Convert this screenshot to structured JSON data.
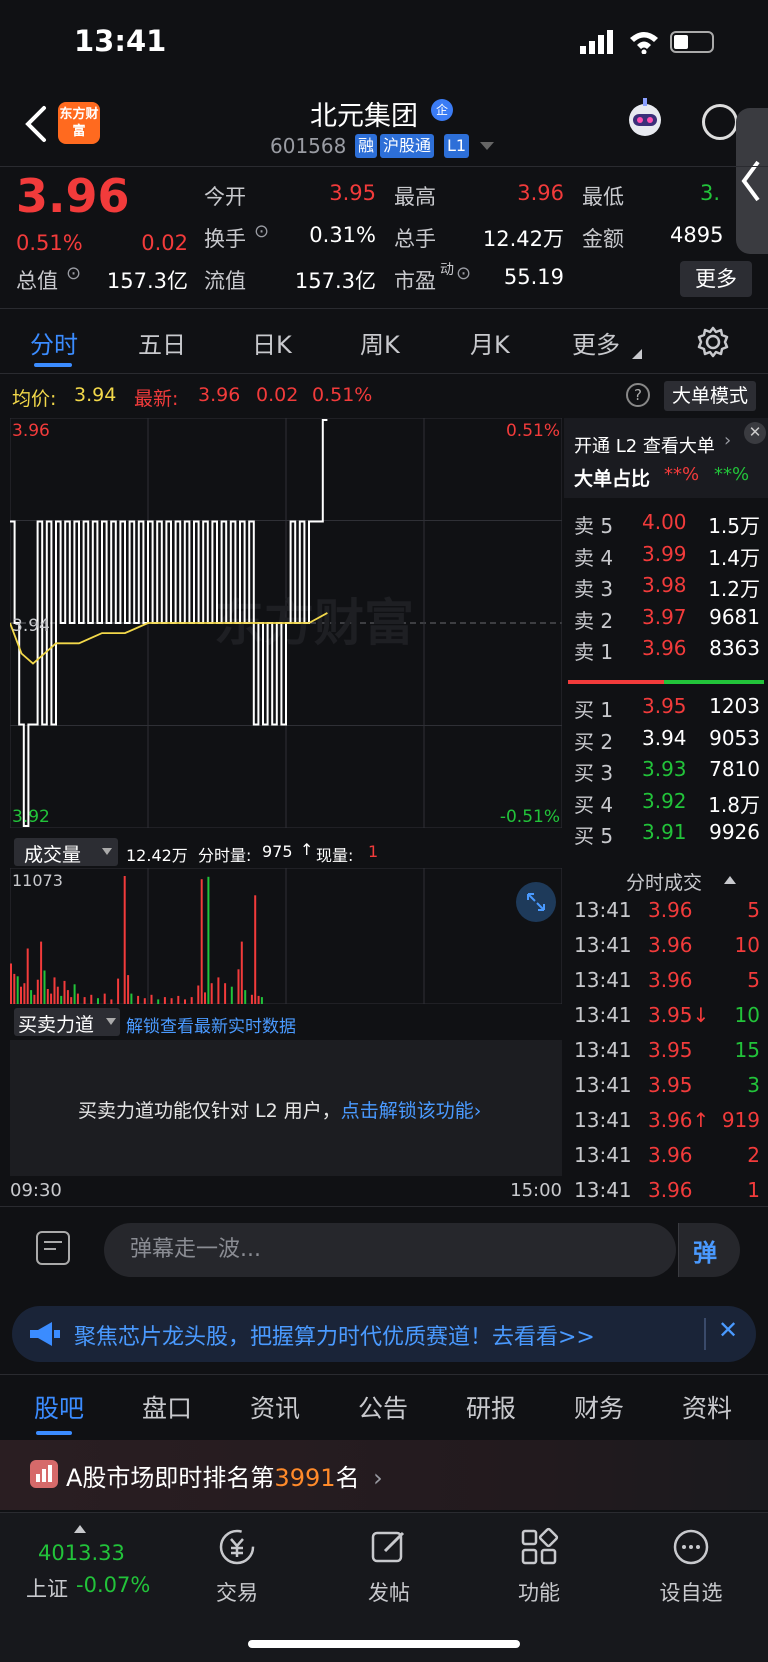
{
  "status": {
    "time": "13:41"
  },
  "header": {
    "brand": "东方财富",
    "stock_name": "北元集团",
    "badge": "企",
    "stock_code": "601568",
    "tags": [
      "融",
      "沪股通",
      "L1"
    ]
  },
  "quote": {
    "price": "3.96",
    "change_pct": "0.51%",
    "change": "0.02",
    "fields": {
      "open_label": "今开",
      "open": "3.95",
      "high_label": "最高",
      "high": "3.96",
      "low_label": "最低",
      "low": "3.",
      "turnover_label": "换手",
      "turnover": "0.31%",
      "volume_label": "总手",
      "volume": "12.42万",
      "amount_label": "金额",
      "amount": "4895",
      "mktcap_label": "总值",
      "mktcap": "157.3亿",
      "float_label": "流值",
      "float": "157.3亿",
      "pe_label": "市盈",
      "pe_sup": "动",
      "pe": "55.19"
    },
    "more": "更多"
  },
  "period_tabs": [
    "分时",
    "五日",
    "日K",
    "周K",
    "月K",
    "更多"
  ],
  "avg_row": {
    "avg_label": "均价:",
    "avg": "3.94",
    "latest_label": "最新:",
    "latest": "3.96",
    "latest_change": "0.02",
    "latest_pct": "0.51%",
    "big_order_mode": "大单模式"
  },
  "chart_labels": {
    "top_price": "3.96",
    "mid_price": "3.94",
    "bottom_price": "3.92",
    "top_pct": "0.51%",
    "bottom_pct": "-0.51%",
    "watermark": "东方财富"
  },
  "volume": {
    "selector": "成交量",
    "summary_total": "12.42万",
    "summary_min_label": "分时量:",
    "summary_min": "975",
    "summary_now_label": "现量:",
    "summary_now": "1",
    "max": "11073"
  },
  "force": {
    "selector": "买卖力道",
    "unlock_link": "解锁查看最新实时数据",
    "message": "买卖力道功能仅针对 L2 用户，",
    "message_link": "点击解锁该功能"
  },
  "time_axis": {
    "start": "09:30",
    "end": "15:00"
  },
  "right_panel": {
    "l2_link": "开通 L2 查看大单",
    "big_ratio_label": "大单占比",
    "big_ratio_red": "**%",
    "big_ratio_green": "**%",
    "asks": [
      {
        "label": "卖 5",
        "price": "4.00",
        "vol": "1.5万",
        "color": "red"
      },
      {
        "label": "卖 4",
        "price": "3.99",
        "vol": "1.4万",
        "color": "red"
      },
      {
        "label": "卖 3",
        "price": "3.98",
        "vol": "1.2万",
        "color": "red"
      },
      {
        "label": "卖 2",
        "price": "3.97",
        "vol": "9681",
        "color": "red"
      },
      {
        "label": "卖 1",
        "price": "3.96",
        "vol": "8363",
        "color": "red"
      }
    ],
    "bids": [
      {
        "label": "买 1",
        "price": "3.95",
        "vol": "1203",
        "color": "red"
      },
      {
        "label": "买 2",
        "price": "3.94",
        "vol": "9053",
        "color": "white"
      },
      {
        "label": "买 3",
        "price": "3.93",
        "vol": "7810",
        "color": "green"
      },
      {
        "label": "买 4",
        "price": "3.92",
        "vol": "1.8万",
        "color": "green"
      },
      {
        "label": "买 5",
        "price": "3.91",
        "vol": "9926",
        "color": "green"
      }
    ],
    "trades_title": "分时成交",
    "trades": [
      {
        "time": "13:41",
        "price": "3.96",
        "vol": "5",
        "pcolor": "red",
        "vcolor": "red"
      },
      {
        "time": "13:41",
        "price": "3.96",
        "vol": "10",
        "pcolor": "red",
        "vcolor": "red"
      },
      {
        "time": "13:41",
        "price": "3.96",
        "vol": "5",
        "pcolor": "red",
        "vcolor": "red"
      },
      {
        "time": "13:41",
        "price": "3.95↓",
        "vol": "10",
        "pcolor": "red",
        "vcolor": "green"
      },
      {
        "time": "13:41",
        "price": "3.95",
        "vol": "15",
        "pcolor": "red",
        "vcolor": "green"
      },
      {
        "time": "13:41",
        "price": "3.95",
        "vol": "3",
        "pcolor": "red",
        "vcolor": "green"
      },
      {
        "time": "13:41",
        "price": "3.96↑",
        "vol": "919",
        "pcolor": "red",
        "vcolor": "red"
      },
      {
        "time": "13:41",
        "price": "3.96",
        "vol": "2",
        "pcolor": "red",
        "vcolor": "red"
      },
      {
        "time": "13:41",
        "price": "3.96",
        "vol": "1",
        "pcolor": "red",
        "vcolor": "red"
      }
    ]
  },
  "danmaku": {
    "placeholder": "弹幕走一波...",
    "send": "弹"
  },
  "ad": {
    "text": "聚焦芯片龙头股，把握算力时代优质赛道！去看看>>"
  },
  "sub_tabs": [
    "股吧",
    "盘口",
    "资讯",
    "公告",
    "研报",
    "财务",
    "资料"
  ],
  "rank": {
    "prefix": "A股市场即时排名第",
    "number": "3991",
    "suffix": "名"
  },
  "bottom_nav": {
    "index_value": "4013.33",
    "index_name": "上证",
    "index_change": "-0.07%",
    "items": [
      "交易",
      "发帖",
      "功能",
      "设自选"
    ]
  },
  "colors": {
    "up": "#f23b3b",
    "down": "#22c33a",
    "avg": "#f2d84a",
    "accent": "#3b8cff"
  },
  "chart_data": {
    "type": "line",
    "x_range": [
      "09:30",
      "15:00"
    ],
    "ylim": [
      3.92,
      3.96
    ],
    "series": [
      {
        "x": [
          0,
          2,
          4,
          6,
          8,
          10,
          12,
          14,
          16,
          18,
          20,
          22,
          24,
          26,
          28,
          30,
          32,
          34,
          36,
          38,
          40,
          42,
          44,
          46,
          48,
          50,
          52,
          54,
          56,
          58,
          60,
          62,
          64,
          66,
          68,
          70,
          72,
          74,
          76,
          78,
          80,
          82,
          84,
          86,
          88,
          90,
          92,
          94,
          96,
          98,
          100,
          102,
          104,
          106,
          108,
          110,
          112,
          114,
          116,
          118,
          120,
          122,
          124,
          126,
          128,
          130,
          132,
          134,
          136,
          138
        ],
        "y": [
          3.95,
          3.94,
          3.93,
          3.92,
          3.93,
          3.93,
          3.95,
          3.93,
          3.95,
          3.93,
          3.95,
          3.94,
          3.95,
          3.94,
          3.95,
          3.94,
          3.95,
          3.94,
          3.95,
          3.94,
          3.95,
          3.94,
          3.95,
          3.94,
          3.95,
          3.94,
          3.95,
          3.94,
          3.95,
          3.94,
          3.95,
          3.94,
          3.95,
          3.94,
          3.95,
          3.94,
          3.95,
          3.94,
          3.95,
          3.94,
          3.95,
          3.94,
          3.95,
          3.94,
          3.95,
          3.94,
          3.95,
          3.94,
          3.95,
          3.94,
          3.95,
          3.94,
          3.95,
          3.93,
          3.94,
          3.93,
          3.94,
          3.93,
          3.94,
          3.93,
          3.94,
          3.95,
          3.94,
          3.95,
          3.94,
          3.95,
          3.95,
          3.95,
          3.96,
          3.96
        ]
      },
      {
        "x": [
          0,
          5,
          10,
          15,
          20,
          30,
          40,
          50,
          60,
          70,
          80,
          90,
          100,
          110,
          120,
          130,
          138
        ],
        "y": [
          3.94,
          3.937,
          3.936,
          3.937,
          3.938,
          3.938,
          3.939,
          3.939,
          3.94,
          3.94,
          3.94,
          3.94,
          3.94,
          3.94,
          3.94,
          3.94,
          3.941
        ]
      }
    ],
    "volume": {
      "max": 11073,
      "bars": [
        {
          "x": 0,
          "v": 3500,
          "c": "r"
        },
        {
          "x": 1,
          "v": 2600,
          "c": "r"
        },
        {
          "x": 2,
          "v": 2400,
          "c": "g"
        },
        {
          "x": 3,
          "v": 1500,
          "c": "r"
        },
        {
          "x": 4,
          "v": 1800,
          "c": "r"
        },
        {
          "x": 5,
          "v": 4800,
          "c": "r"
        },
        {
          "x": 6,
          "v": 1200,
          "c": "g"
        },
        {
          "x": 7,
          "v": 800,
          "c": "r"
        },
        {
          "x": 8,
          "v": 2100,
          "c": "r"
        },
        {
          "x": 9,
          "v": 5400,
          "c": "r"
        },
        {
          "x": 10,
          "v": 2900,
          "c": "g"
        },
        {
          "x": 11,
          "v": 1300,
          "c": "r"
        },
        {
          "x": 12,
          "v": 900,
          "c": "r"
        },
        {
          "x": 13,
          "v": 2300,
          "c": "r"
        },
        {
          "x": 14,
          "v": 1500,
          "c": "r"
        },
        {
          "x": 15,
          "v": 700,
          "c": "g"
        },
        {
          "x": 16,
          "v": 2000,
          "c": "r"
        },
        {
          "x": 17,
          "v": 1200,
          "c": "r"
        },
        {
          "x": 18,
          "v": 600,
          "c": "r"
        },
        {
          "x": 19,
          "v": 1700,
          "c": "g"
        },
        {
          "x": 20,
          "v": 900,
          "c": "r"
        },
        {
          "x": 22,
          "v": 600,
          "c": "r"
        },
        {
          "x": 24,
          "v": 800,
          "c": "r"
        },
        {
          "x": 26,
          "v": 500,
          "c": "g"
        },
        {
          "x": 28,
          "v": 900,
          "c": "r"
        },
        {
          "x": 30,
          "v": 400,
          "c": "r"
        },
        {
          "x": 32,
          "v": 2200,
          "c": "r"
        },
        {
          "x": 34,
          "v": 11073,
          "c": "r"
        },
        {
          "x": 35,
          "v": 2500,
          "c": "r"
        },
        {
          "x": 36,
          "v": 900,
          "c": "g"
        },
        {
          "x": 38,
          "v": 700,
          "c": "r"
        },
        {
          "x": 40,
          "v": 500,
          "c": "r"
        },
        {
          "x": 42,
          "v": 800,
          "c": "r"
        },
        {
          "x": 44,
          "v": 400,
          "c": "g"
        },
        {
          "x": 46,
          "v": 600,
          "c": "r"
        },
        {
          "x": 48,
          "v": 500,
          "c": "r"
        },
        {
          "x": 50,
          "v": 700,
          "c": "r"
        },
        {
          "x": 52,
          "v": 400,
          "c": "r"
        },
        {
          "x": 54,
          "v": 600,
          "c": "r"
        },
        {
          "x": 56,
          "v": 1600,
          "c": "r"
        },
        {
          "x": 57,
          "v": 10800,
          "c": "r"
        },
        {
          "x": 58,
          "v": 1000,
          "c": "r"
        },
        {
          "x": 59,
          "v": 11000,
          "c": "g"
        },
        {
          "x": 60,
          "v": 1800,
          "c": "r"
        },
        {
          "x": 62,
          "v": 2300,
          "c": "r"
        },
        {
          "x": 64,
          "v": 1800,
          "c": "r"
        },
        {
          "x": 66,
          "v": 1500,
          "c": "g"
        },
        {
          "x": 68,
          "v": 3000,
          "c": "r"
        },
        {
          "x": 69,
          "v": 5400,
          "c": "r"
        },
        {
          "x": 70,
          "v": 1200,
          "c": "g"
        },
        {
          "x": 72,
          "v": 800,
          "c": "r"
        },
        {
          "x": 73,
          "v": 9400,
          "c": "r"
        },
        {
          "x": 74,
          "v": 700,
          "c": "r"
        },
        {
          "x": 75,
          "v": 600,
          "c": "g"
        }
      ]
    }
  }
}
